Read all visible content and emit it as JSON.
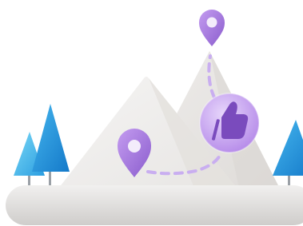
{
  "illustration": {
    "colors": {
      "pin": "#a97be0",
      "pin_dark": "#8e5fd0",
      "pin_hole": "#f3ecfb",
      "path_dash": "#c9aef0",
      "badge_outer": "#d9c3f6",
      "badge_inner": "#b689ea",
      "thumb": "#7d4fbf",
      "mountain": "#eeecea",
      "mountain_shadow": "#d9d6d3",
      "ground": "#d6d4d2",
      "tree_light": "#6fd0f3",
      "tree_dark": "#1e8fd6",
      "trunk": "#9aa0a6"
    },
    "icons": [
      "location-pin-icon",
      "thumbs-up-icon"
    ]
  }
}
